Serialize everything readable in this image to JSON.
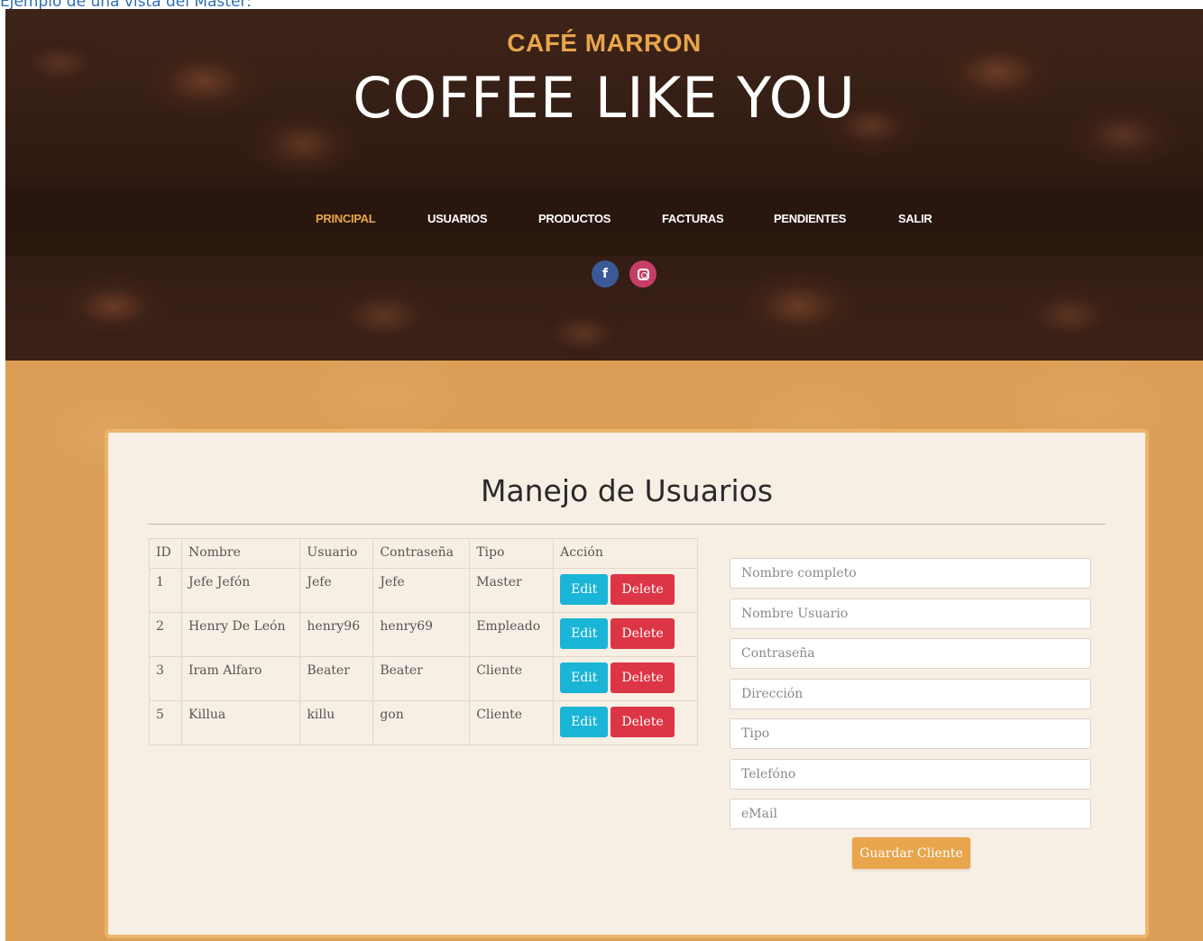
{
  "caption": "Ejemplo de una vista del Master:",
  "header": {
    "brand": "CAFÉ MARRON",
    "tagline": "COFFEE LIKE YOU",
    "nav": [
      {
        "label": "PRINCIPAL",
        "active": true
      },
      {
        "label": "USUARIOS",
        "active": false
      },
      {
        "label": "PRODUCTOS",
        "active": false
      },
      {
        "label": "FACTURAS",
        "active": false
      },
      {
        "label": "PENDIENTES",
        "active": false
      },
      {
        "label": "SALIR",
        "active": false
      }
    ],
    "social": [
      {
        "icon": "facebook-icon",
        "glyph": "f",
        "color": "#3b5998"
      },
      {
        "icon": "instagram-icon",
        "color": "#c63d68"
      }
    ]
  },
  "main": {
    "title": "Manejo de Usuarios",
    "table": {
      "columns": [
        "ID",
        "Nombre",
        "Usuario",
        "Contraseña",
        "Tipo",
        "Acción"
      ],
      "rows": [
        {
          "id": "1",
          "nombre": "Jefe Jefón",
          "usuario": "Jefe",
          "contrasena": "Jefe",
          "tipo": "Master"
        },
        {
          "id": "2",
          "nombre": "Henry De León",
          "usuario": "henry96",
          "contrasena": "henry69",
          "tipo": "Empleado"
        },
        {
          "id": "3",
          "nombre": "Iram Alfaro",
          "usuario": "Beater",
          "contrasena": "Beater",
          "tipo": "Cliente"
        },
        {
          "id": "5",
          "nombre": "Killua",
          "usuario": "killu",
          "contrasena": "gon",
          "tipo": "Cliente"
        }
      ],
      "edit_label": "Edit",
      "delete_label": "Delete"
    },
    "form": {
      "placeholders": {
        "nombre": "Nombre completo",
        "usuario": "Nombre Usuario",
        "contrasena": "Contraseña",
        "direccion": "Dirección",
        "tipo": "Tipo",
        "telefono": "Telefóno",
        "email": "eMail"
      },
      "submit_label": "Guardar Cliente"
    }
  },
  "colors": {
    "accent": "#e8a54b",
    "edit": "#1ab5d6",
    "delete": "#dc3545",
    "background": "#dc9e56"
  }
}
